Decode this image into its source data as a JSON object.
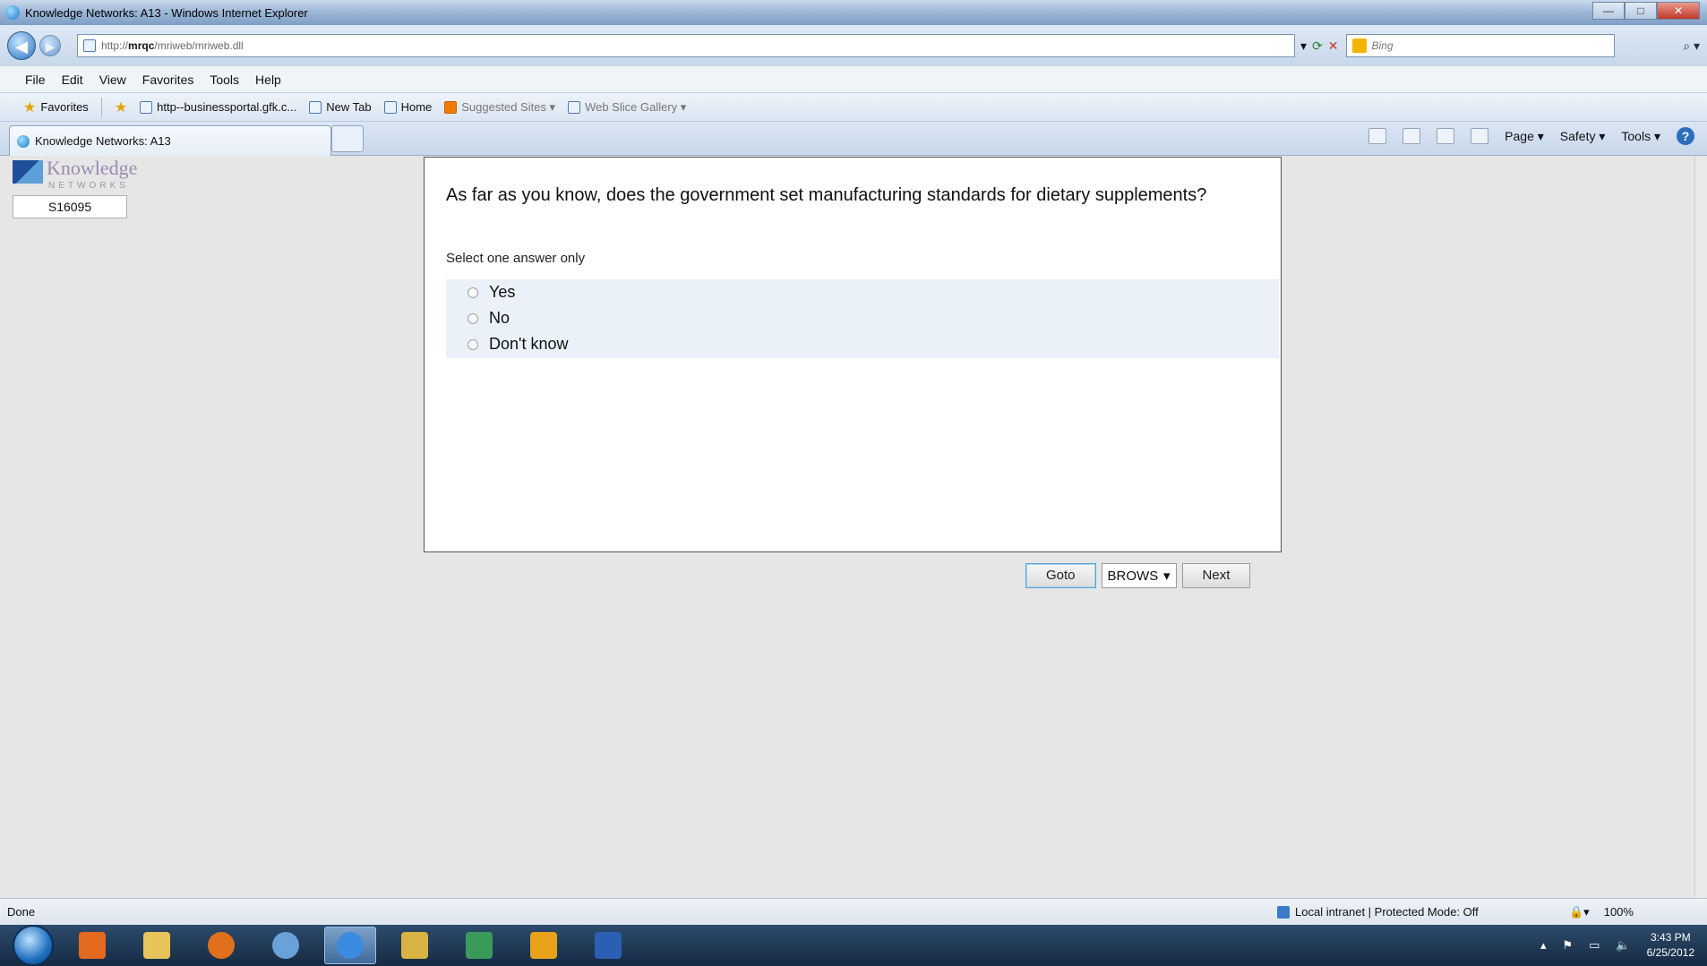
{
  "window": {
    "title": "Knowledge Networks: A13 - Windows Internet Explorer",
    "buttons": [
      "—",
      "□",
      "✕"
    ]
  },
  "address": {
    "url_prefix": "http://",
    "url_host": "mrqc",
    "url_path": "/mriweb/mriweb.dll",
    "search_placeholder": "Bing"
  },
  "menu": {
    "items": [
      "File",
      "Edit",
      "View",
      "Favorites",
      "Tools",
      "Help"
    ]
  },
  "favorites": {
    "label": "Favorites",
    "items": [
      "http--businessportal.gfk.c...",
      "New Tab",
      "Home",
      "Suggested Sites ▾",
      "Web Slice Gallery ▾"
    ]
  },
  "tab": {
    "label": "Knowledge Networks: A13"
  },
  "command_bar": {
    "page": "Page ▾",
    "safety": "Safety ▾",
    "tools": "Tools ▾",
    "help": "?"
  },
  "sidebar": {
    "logo_word": "Knowledge",
    "logo_sub": "NETWORKS",
    "respondent_id": "S16095"
  },
  "survey": {
    "question": "As far as you know, does the government set manufacturing standards for dietary supplements?",
    "instruction": "Select one answer only",
    "options": [
      "Yes",
      "No",
      "Don't know"
    ]
  },
  "navigation": {
    "goto": "Goto",
    "select_value": "BROWS",
    "next": "Next"
  },
  "status": {
    "text": "Done",
    "zone": "Local intranet | Protected Mode: Off",
    "zoom": "100%"
  },
  "clock": {
    "time": "3:43 PM",
    "date": "6/25/2012"
  },
  "colors": {
    "taskbar": "#1f3654",
    "panel_bg": "#ffffff",
    "answers_bg": "#eaf1f9"
  }
}
